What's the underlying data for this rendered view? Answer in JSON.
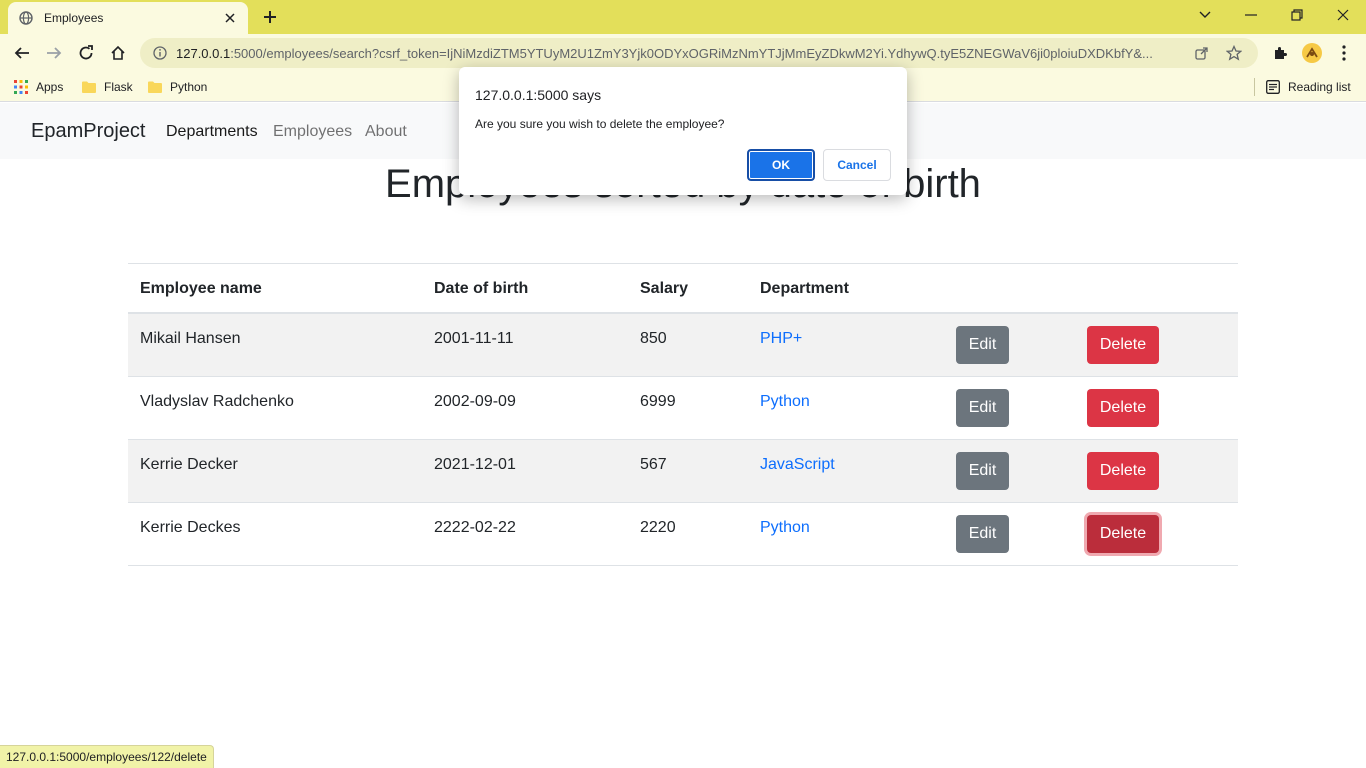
{
  "browser": {
    "tab_title": "Employees",
    "url_host": "127.0.0.1",
    "url_rest": ":5000/employees/search?csrf_token=IjNiMzdiZTM5YTUyM2U1ZmY3Yjk0ODYxOGRiMzNmYTJjMmEyZDkwM2Yi.YdhywQ.tyE5ZNEGWaV6ji0ploiuDXDKbfY&...",
    "bookmarks": [
      {
        "label": "Apps"
      },
      {
        "label": "Flask"
      },
      {
        "label": "Python"
      }
    ],
    "reading_list": "Reading list",
    "status_url": "127.0.0.1:5000/employees/122/delete"
  },
  "site": {
    "brand": "EpamProject",
    "nav": [
      "Departments",
      "Employees",
      "About"
    ]
  },
  "page": {
    "heading": "Employees sorted by date of birth"
  },
  "table": {
    "headers": [
      "Employee name",
      "Date of birth",
      "Salary",
      "Department"
    ],
    "edit_label": "Edit",
    "delete_label": "Delete",
    "rows": [
      {
        "name": "Mikail Hansen",
        "dob": "2001-11-11",
        "salary": "850",
        "department": "PHP+"
      },
      {
        "name": "Vladyslav Radchenko",
        "dob": "2002-09-09",
        "salary": "6999",
        "department": "Python"
      },
      {
        "name": "Kerrie Decker",
        "dob": "2021-12-01",
        "salary": "567",
        "department": "JavaScript"
      },
      {
        "name": "Kerrie Deckes",
        "dob": "2222-02-22",
        "salary": "2220",
        "department": "Python"
      }
    ]
  },
  "dialog": {
    "origin": "127.0.0.1:5000 says",
    "message": "Are you sure you wish to delete the employee?",
    "ok": "OK",
    "cancel": "Cancel"
  },
  "colors": {
    "tabbar": "#e3df5a",
    "edit_button": "#6c757d",
    "delete_button": "#dc3545",
    "link": "#0d6efd",
    "dialog_ok": "#1a73e8"
  }
}
